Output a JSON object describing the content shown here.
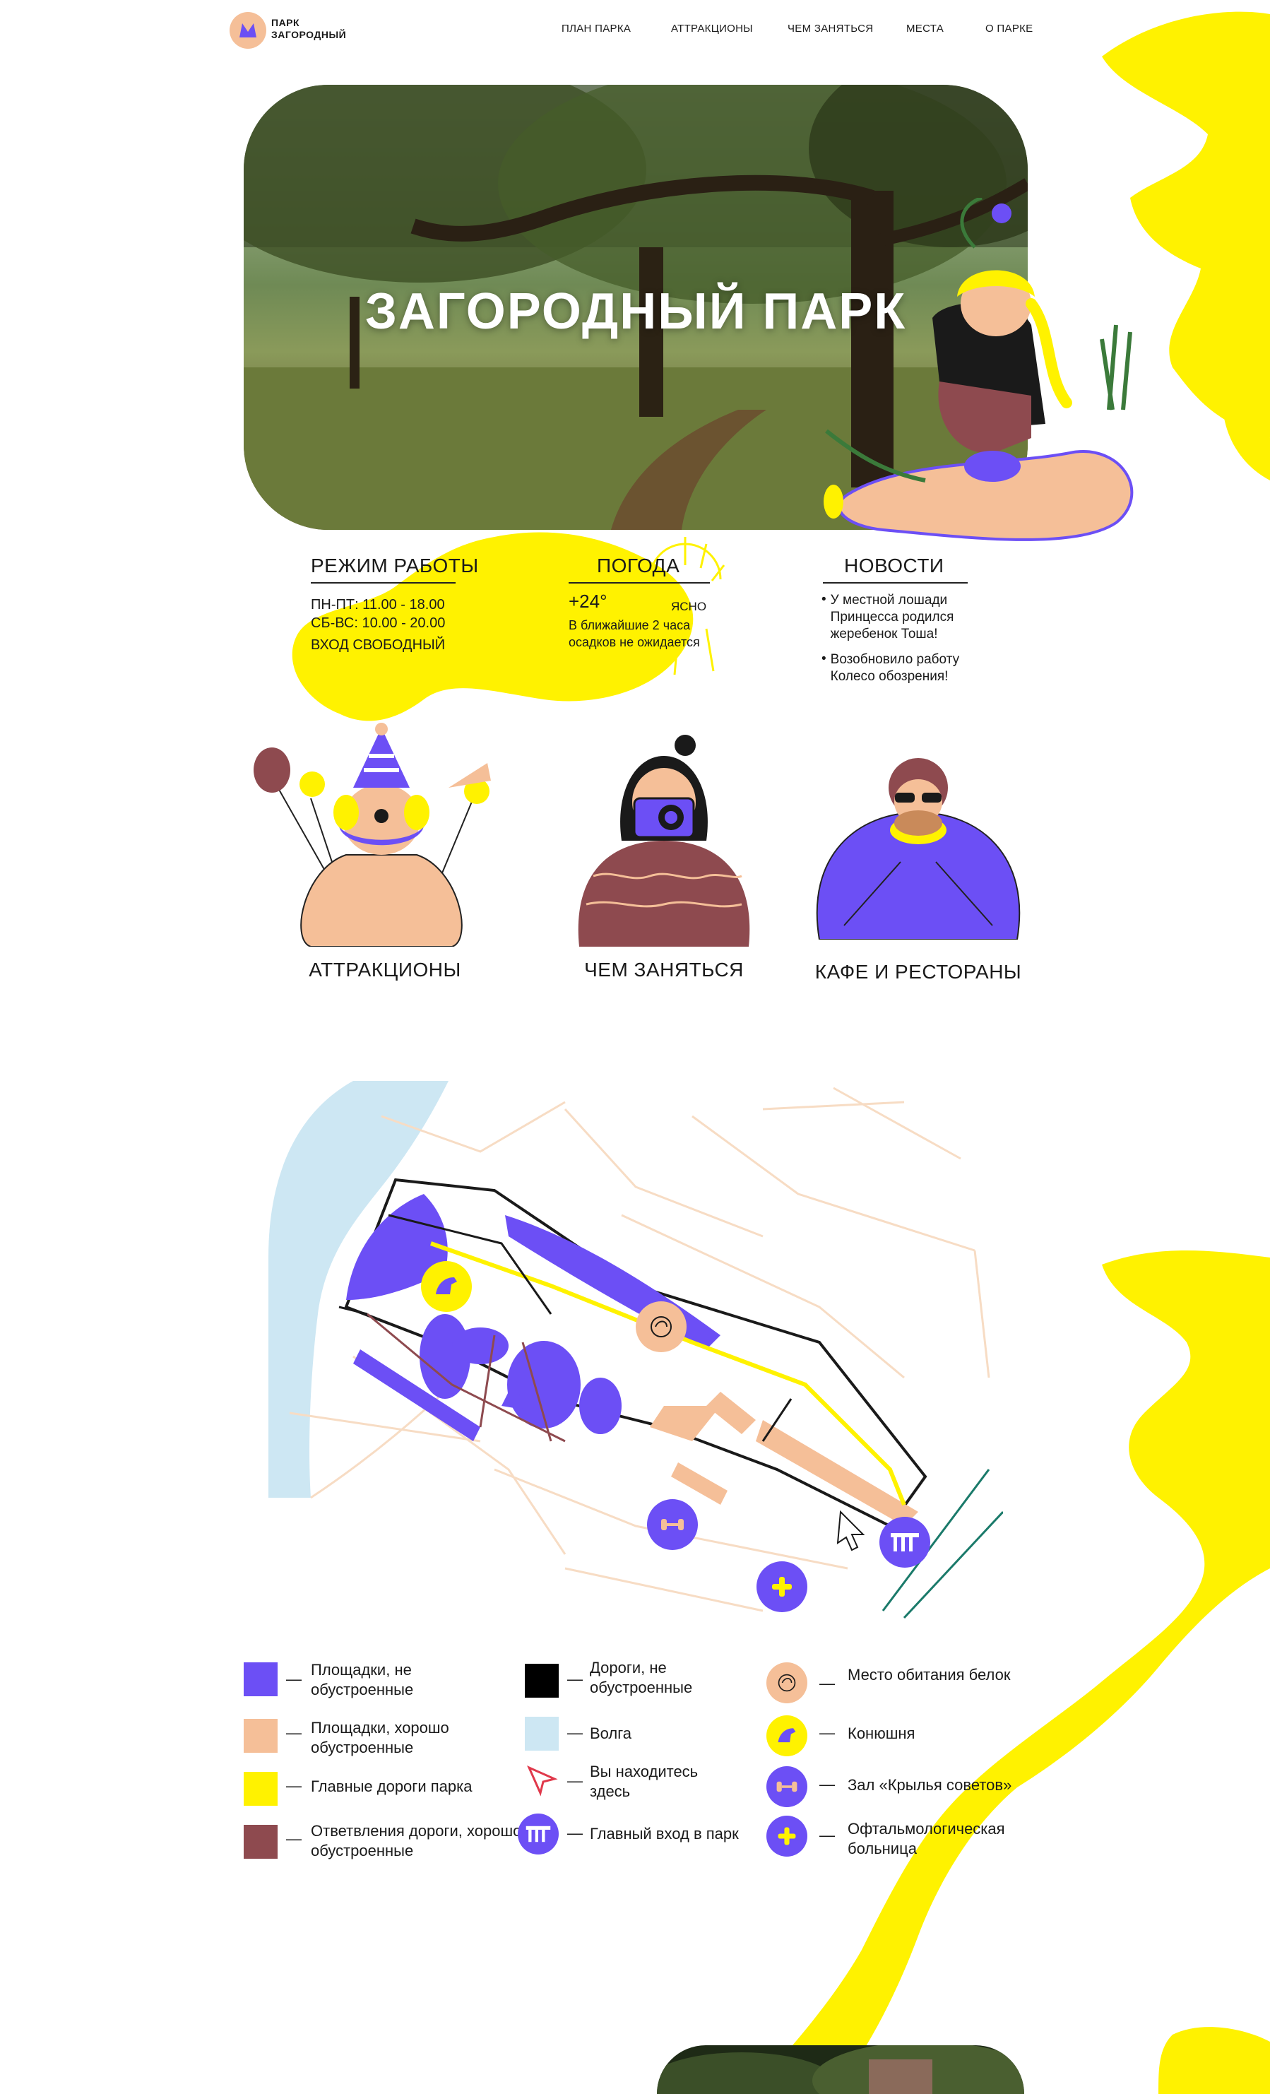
{
  "header": {
    "logo_line1": "ПАРК",
    "logo_line2": "ЗАГОРОДНЫЙ",
    "nav": [
      "ПЛАН ПАРКА",
      "АТТРАКЦИОНЫ",
      "ЧЕМ ЗАНЯТЬСЯ",
      "МЕСТА",
      "О ПАРКЕ"
    ]
  },
  "hero": {
    "title": "ЗАГОРОДНЫЙ ПАРК"
  },
  "hours": {
    "title": "РЕЖИМ РАБОТЫ",
    "weekdays": "ПН-ПТ:   11.00 - 18.00",
    "weekend": "СБ-ВС:   10.00 - 20.00",
    "entry": "ВХОД СВОБОДНЫЙ"
  },
  "weather": {
    "title": "ПОГОДА",
    "temp": "+24°",
    "condition": "ЯСНО",
    "forecast_line1": "В ближайшие 2 часа",
    "forecast_line2": "осадков не ожидается"
  },
  "news": {
    "title": "НОВОСТИ",
    "items": [
      "У местной лошади Принцесса родился жеребенок Тоша!",
      "Возобновило работу Колесо обозрения!"
    ]
  },
  "categories": [
    "АТТРАКЦИОНЫ",
    "ЧЕМ ЗАНЯТЬСЯ",
    "КАФЕ И  РЕСТОРАНЫ"
  ],
  "legend": {
    "col1": [
      "Площадки, не обустроенные",
      "Площадки, хорошо обустроенные",
      "Главные дороги парка",
      "Ответвления дороги, хорошо обустроенные"
    ],
    "col2": [
      "Дороги, не обустроенные",
      "Волга",
      "Вы находитесь здесь",
      "Главный вход в парк"
    ],
    "col3": [
      "Место обитания белок",
      "Конюшня",
      "Зал «Крылья советов»",
      "Офтальмологическая больница"
    ]
  },
  "colors": {
    "purple": "#6c4ff5",
    "peach": "#f5bf98",
    "yellow": "#fff200",
    "brown": "#8e4a4f",
    "river": "#cde7f3",
    "black": "#000000"
  }
}
